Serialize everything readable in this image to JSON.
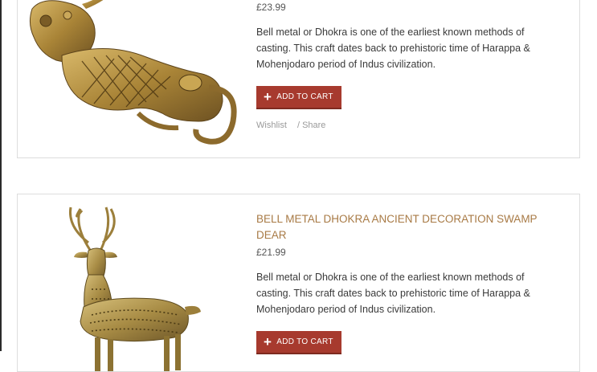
{
  "products": [
    {
      "title": "",
      "price": "£23.99",
      "description": "Bell metal or Dhokra is one of the earliest known methods of casting. This craft dates back to prehistoric time of Harappa & Mohenjodaro period of Indus civilization.",
      "cart_label": "ADD TO CART",
      "wishlist_label": "Wishlist",
      "share_label": "/ Share"
    },
    {
      "title": "BELL METAL DHOKRA ANCIENT DECORATION SWAMP DEAR",
      "price": "£21.99",
      "description": "Bell metal or Dhokra is one of the earliest known methods of casting. This craft dates back to prehistoric time of Harappa & Mohenjodaro period of Indus civilization.",
      "cart_label": "ADD TO CART"
    }
  ],
  "colors": {
    "title": "#a87a45",
    "button": "#a73a2e",
    "brass": "#b08a3e"
  }
}
